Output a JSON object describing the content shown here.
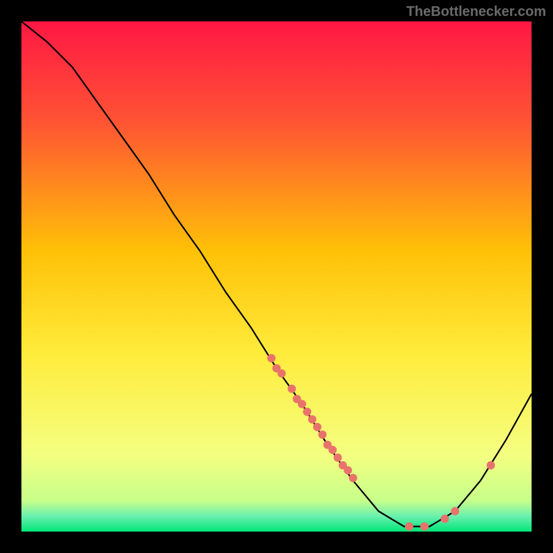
{
  "attribution": "TheBottlenecker.com",
  "chart_data": {
    "type": "line",
    "title": "",
    "xlabel": "",
    "ylabel": "",
    "xlim": [
      0,
      100
    ],
    "ylim": [
      0,
      100
    ],
    "curve": [
      {
        "x": 0,
        "y": 100
      },
      {
        "x": 5,
        "y": 96
      },
      {
        "x": 10,
        "y": 91
      },
      {
        "x": 15,
        "y": 84
      },
      {
        "x": 20,
        "y": 77
      },
      {
        "x": 25,
        "y": 70
      },
      {
        "x": 30,
        "y": 62
      },
      {
        "x": 35,
        "y": 55
      },
      {
        "x": 40,
        "y": 47
      },
      {
        "x": 45,
        "y": 40
      },
      {
        "x": 50,
        "y": 32
      },
      {
        "x": 55,
        "y": 25
      },
      {
        "x": 60,
        "y": 17
      },
      {
        "x": 65,
        "y": 10
      },
      {
        "x": 70,
        "y": 4
      },
      {
        "x": 75,
        "y": 1
      },
      {
        "x": 80,
        "y": 1
      },
      {
        "x": 85,
        "y": 4
      },
      {
        "x": 90,
        "y": 10
      },
      {
        "x": 95,
        "y": 18
      },
      {
        "x": 100,
        "y": 27
      }
    ],
    "markers": [
      {
        "x": 49,
        "y": 34
      },
      {
        "x": 50,
        "y": 32
      },
      {
        "x": 51,
        "y": 31
      },
      {
        "x": 53,
        "y": 28
      },
      {
        "x": 54,
        "y": 26
      },
      {
        "x": 55,
        "y": 25
      },
      {
        "x": 56,
        "y": 23.5
      },
      {
        "x": 57,
        "y": 22
      },
      {
        "x": 58,
        "y": 20.5
      },
      {
        "x": 59,
        "y": 19
      },
      {
        "x": 60,
        "y": 17
      },
      {
        "x": 61,
        "y": 16
      },
      {
        "x": 62,
        "y": 14.5
      },
      {
        "x": 63,
        "y": 13
      },
      {
        "x": 64,
        "y": 12
      },
      {
        "x": 65,
        "y": 10.5
      },
      {
        "x": 76,
        "y": 1
      },
      {
        "x": 79,
        "y": 1
      },
      {
        "x": 83,
        "y": 2.5
      },
      {
        "x": 85,
        "y": 4
      },
      {
        "x": 92,
        "y": 13
      }
    ],
    "marker_color": "#e8736b",
    "line_color": "#000000",
    "background_gradient": {
      "top": "#ff1744",
      "upper_mid": "#ffea00",
      "lower_mid": "#eeff41",
      "bottom_band": "#00e676"
    }
  }
}
